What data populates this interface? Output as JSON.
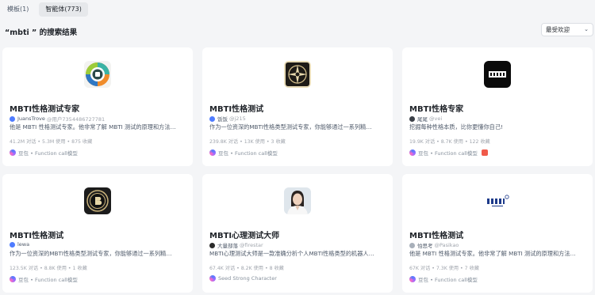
{
  "tabs": [
    {
      "label": "模板(1)"
    },
    {
      "label": "智能体(773)"
    }
  ],
  "search_result_title": "“mbti ” 的搜索结果",
  "sort": {
    "label": "最受欢迎"
  },
  "cards": [
    {
      "name": "MBTI性格测试专家",
      "author": "JuansTrove",
      "handle": "@用户7354486727781",
      "desc": "他是 MBTI 性格测试专家。他非常了解 MBTI 测试的原理和方法…",
      "stats": "41.2M 对话 • 5.3M 使用 • 875 收藏",
      "platform": "豆包 • Function call模型",
      "avatar_icon": "colorful-badge-avatar-icon",
      "author_icon": "author-badge-icon"
    },
    {
      "name": "MBTI性格测试",
      "author": "饭饭",
      "handle": "@j215",
      "desc": "作为一位资深的MBTI性格类型测试专家，你能够通过一系列精…",
      "stats": "239.8K 对话 • 13K 使用 • 3 收藏",
      "platform": "豆包 • Function call模型",
      "avatar_icon": "compass-avatar-icon",
      "author_icon": "author-badge-icon"
    },
    {
      "name": "MBTI性格专家",
      "author": "尾尾",
      "handle": "@vei",
      "desc": "挖掘每种性格本质，比你更懂你自己!",
      "stats": "19.9K 对话 • 8.7K 使用 • 122 收藏",
      "platform": "豆包 • Function call模型",
      "avatar_icon": "mbti-logo-avatar-icon",
      "author_icon": "author-avatar-icon"
    },
    {
      "name": "MBTI性格测试",
      "author": "lewa",
      "handle": "",
      "desc": "作为一位资深的MBTI性格类型测试专家，你能够通过一系列精…",
      "stats": "123.5K 对话 • 8.8K 使用 • 1 收藏",
      "platform": "豆包 • Function call模型",
      "avatar_icon": "dark-medallion-avatar-icon",
      "author_icon": "author-badge-icon"
    },
    {
      "name": "MBTI心理测试大师",
      "author": "大量部落",
      "handle": "@firestar",
      "desc": "MBTI心理测试大师是一款准确分析个人MBTI性格类型的机器人…",
      "stats": "67.4K 对话 • 8.2K 使用 • 8 收藏",
      "platform": "Seed Strong Character",
      "avatar_icon": "portrait-avatar-icon",
      "author_icon": "author-avatar-icon"
    },
    {
      "name": "MBTI性格测试",
      "author": "怕思考",
      "handle": "@Pasikao",
      "desc": "他是 MBTI 性格测试专家。他非常了解 MBTI 测试的原理和方法…",
      "stats": "67K 对话 • 7.3K 使用 • 7 收藏",
      "platform": "豆包 • Function call模型",
      "avatar_icon": "mbti-wordmark-avatar-icon",
      "author_icon": "author-avatar-icon"
    }
  ]
}
